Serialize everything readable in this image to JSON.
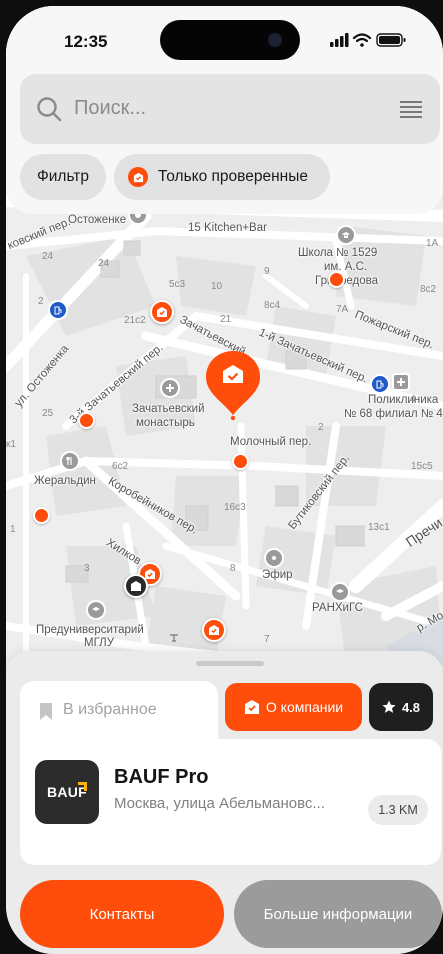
{
  "status": {
    "time": "12:35"
  },
  "search": {
    "placeholder": "Поиск..."
  },
  "chips": {
    "filter": "Фильтр",
    "verified": "Только проверенные"
  },
  "map": {
    "streets": [
      "Остоженке",
      "ковский пер.",
      "15 Kitchen+Bar",
      "Школа № 1529",
      "им. А.С.",
      "Грибоедова",
      "Пожарский пер.",
      "Зачатьевский",
      "1-й Зачатьевский пер.",
      "ул. Остоженка",
      "3-й Зачатьевский пер.",
      "Зачатьевский",
      "монастырь",
      "Молочный пер.",
      "Поликлиника",
      "№ 68 филиал № 4",
      "Жеральдин",
      "Коробейников пер.",
      "Бутиковский пер.",
      "Хилков",
      "Пречи",
      "Эфир",
      "РАНХиГС",
      "Предуниверситарий",
      "МГЛУ",
      "р. Мо"
    ],
    "numbers": [
      "24",
      "24",
      "5с3",
      "10",
      "9",
      "1А",
      "2",
      "21с2",
      "8с4",
      "7А",
      "8с2",
      "4",
      "25",
      "21",
      "2",
      "6с2",
      "15с5",
      "16с3",
      "13с1",
      "к1",
      "1",
      "3",
      "8",
      "7"
    ]
  },
  "sheet": {
    "favorite": "В избранное",
    "about": "О компании",
    "rating": "4.8",
    "company": {
      "logo_text": "BAUF",
      "name": "BAUF Pro",
      "address": "Москва, улица Абельмановс...",
      "distance": "1.3 KM"
    },
    "contacts": "Контакты",
    "more": "Больше информации"
  },
  "colors": {
    "accent": "#ff4d0b",
    "dark": "#1f1f1f",
    "grey_button": "#9b9b9b"
  }
}
